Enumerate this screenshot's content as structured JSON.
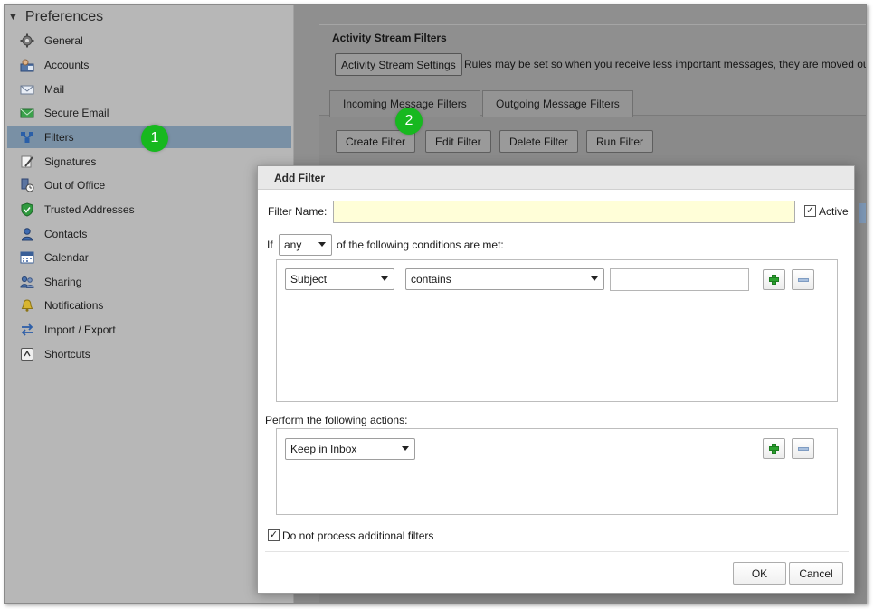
{
  "sidebar": {
    "title": "Preferences",
    "items": [
      {
        "label": "General",
        "icon": "gear-icon"
      },
      {
        "label": "Accounts",
        "icon": "accounts-icon"
      },
      {
        "label": "Mail",
        "icon": "mail-icon"
      },
      {
        "label": "Secure Email",
        "icon": "secure-email-icon"
      },
      {
        "label": "Filters",
        "icon": "filter-icon",
        "selected": true
      },
      {
        "label": "Signatures",
        "icon": "signature-icon"
      },
      {
        "label": "Out of Office",
        "icon": "out-of-office-icon"
      },
      {
        "label": "Trusted Addresses",
        "icon": "shield-icon"
      },
      {
        "label": "Contacts",
        "icon": "contacts-icon"
      },
      {
        "label": "Calendar",
        "icon": "calendar-icon"
      },
      {
        "label": "Sharing",
        "icon": "sharing-icon"
      },
      {
        "label": "Notifications",
        "icon": "bell-icon"
      },
      {
        "label": "Import / Export",
        "icon": "import-export-icon"
      },
      {
        "label": "Shortcuts",
        "icon": "keyboard-shortcut-icon"
      }
    ]
  },
  "background": {
    "section_title": "Activity Stream Filters",
    "settings_button": "Activity Stream Settings",
    "description": "Rules may be set so when you receive less important messages, they are moved ou",
    "tabs": [
      "Incoming Message Filters",
      "Outgoing Message Filters"
    ],
    "buttons": [
      "Create Filter",
      "Edit Filter",
      "Delete Filter",
      "Run Filter"
    ]
  },
  "markers": [
    "1",
    "2"
  ],
  "dialog": {
    "title": "Add Filter",
    "filter_name_label": "Filter Name:",
    "filter_name_value": "",
    "active_label": "Active",
    "active_checked": true,
    "if_label": "If",
    "match_select": "any",
    "conditions_label": "of the following conditions are met:",
    "condition": {
      "field": "Subject",
      "operator": "contains",
      "value": ""
    },
    "actions_label": "Perform the following actions:",
    "action": "Keep in Inbox",
    "no_more_filters_label": "Do not process additional filters",
    "no_more_filters_checked": true,
    "ok_label": "OK",
    "cancel_label": "Cancel"
  },
  "colors": {
    "selected_nav": "#7990a5",
    "marker": "#17b81f",
    "input_highlight": "#fffed8"
  }
}
